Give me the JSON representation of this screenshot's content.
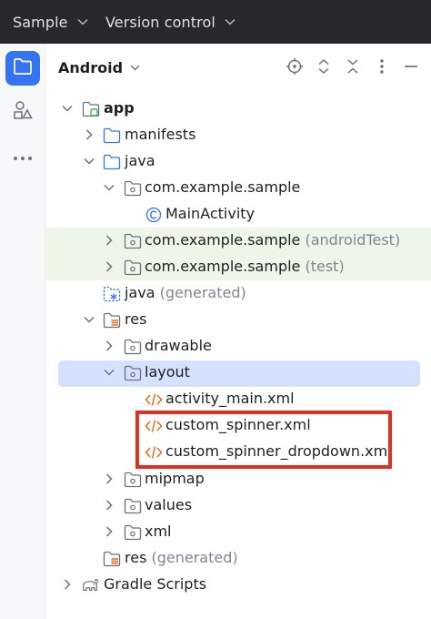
{
  "topbar": {
    "project_label": "Sample",
    "vcs_label": "Version control"
  },
  "strip": {
    "items": [
      {
        "name": "project-view-icon",
        "active": true
      },
      {
        "name": "resource-manager-icon",
        "active": false
      },
      {
        "name": "more-tools-icon",
        "active": false
      }
    ]
  },
  "panel": {
    "view_label": "Android",
    "header_icons": [
      "locate-icon",
      "expand-all-icon",
      "collapse-all-icon",
      "options-icon",
      "hide-icon"
    ]
  },
  "tree": {
    "app": "app",
    "manifests": "manifests",
    "java": "java",
    "pkg_main": "com.example.sample",
    "main_activity": "MainActivity",
    "pkg_android_test": "com.example.sample",
    "pkg_android_test_suffix": "(androidTest)",
    "pkg_test": "com.example.sample",
    "pkg_test_suffix": "(test)",
    "java_gen": "java",
    "java_gen_suffix": "(generated)",
    "res": "res",
    "drawable": "drawable",
    "layout": "layout",
    "activity_main": "activity_main.xml",
    "custom_spinner": "custom_spinner.xml",
    "custom_spinner_dropdown": "custom_spinner_dropdown.xml",
    "mipmap": "mipmap",
    "values": "values",
    "xml": "xml",
    "res_gen": "res",
    "res_gen_suffix": "(generated)",
    "gradle_scripts": "Gradle Scripts"
  },
  "colors": {
    "topbar_bg": "#27282c",
    "accent": "#3574f0",
    "selection": "#d4e2ff",
    "test_source_bg": "#edf6e8",
    "highlight_border": "#e0301e",
    "xml_icon": "#e66d17"
  }
}
